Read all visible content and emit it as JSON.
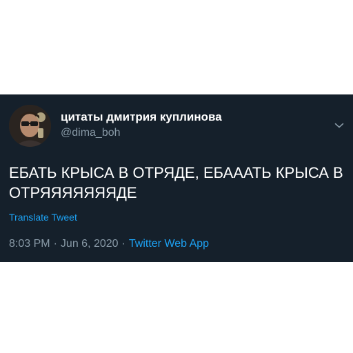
{
  "tweet": {
    "author": {
      "display_name": "цитаты дмитрия куплинова",
      "handle": "@dima_boh",
      "avatar_icon": "profile-photo"
    },
    "text": "ЕБАТЬ КРЫСА В ОТРЯДЕ, ЕБАААТЬ КРЫСА В ОТРЯЯЯЯЯЯЯДЕ",
    "translate_label": "Translate Tweet",
    "time": "8:03 PM",
    "date": "Jun 6, 2020",
    "separator": "·",
    "source": "Twitter Web App",
    "more_icon": "chevron-down-icon"
  },
  "colors": {
    "background": "#15202b",
    "text_primary": "#ffffff",
    "text_secondary": "#8899a6",
    "accent": "#1da1f2"
  }
}
